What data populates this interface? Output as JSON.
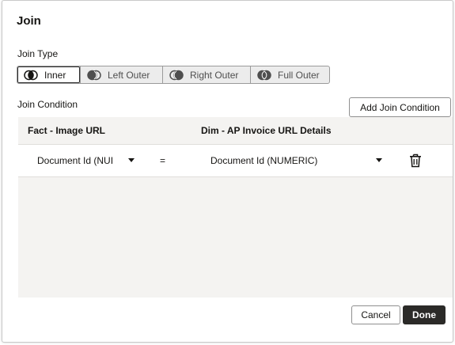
{
  "dialog": {
    "title": "Join",
    "join_type_label": "Join Type",
    "join_condition_label": "Join Condition",
    "join_types": [
      {
        "label": "Inner",
        "icon": "inner-join-icon",
        "selected": true
      },
      {
        "label": "Left Outer",
        "icon": "left-outer-join-icon",
        "selected": false
      },
      {
        "label": "Right Outer",
        "icon": "right-outer-join-icon",
        "selected": false
      },
      {
        "label": "Full Outer",
        "icon": "full-outer-join-icon",
        "selected": false
      }
    ],
    "add_join_condition_label": "Add Join Condition",
    "table": {
      "left_header": "Fact - Image URL",
      "right_header": "Dim - AP Invoice URL Details",
      "rows": [
        {
          "left_value": "Document Id (NUI",
          "operator": "=",
          "right_value": "Document Id (NUMERIC)"
        }
      ]
    },
    "cancel_label": "Cancel",
    "done_label": "Done"
  },
  "colors": {
    "primary_button": "#2b2a28",
    "panel_background": "#f4f3f1",
    "segment_background": "#ececec"
  }
}
